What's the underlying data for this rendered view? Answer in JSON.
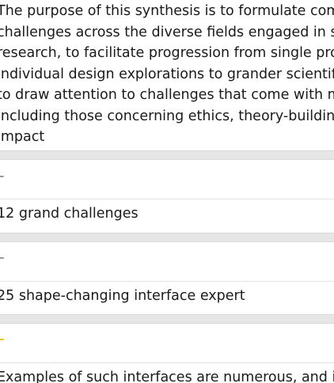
{
  "summary": {
    "lines": [
      "The purpose of this synthesis is to formulate comm",
      "challenges across the diverse fields engaged in sha",
      "research, to facilitate progression from single proto",
      "individual design explorations to grander scientific",
      "to draw attention to challenges that come with ma",
      "including those concerning ethics, theory-building,",
      "impact"
    ]
  },
  "cards": [
    {
      "marker_color": "#9a9a9a",
      "label": "12 grand challenges"
    },
    {
      "marker_color": "#9a9a9a",
      "label": "25 shape-changing interface expert"
    },
    {
      "marker_color": "#f2c200",
      "label": "Examples of such interfaces are numerous, and inc"
    }
  ]
}
